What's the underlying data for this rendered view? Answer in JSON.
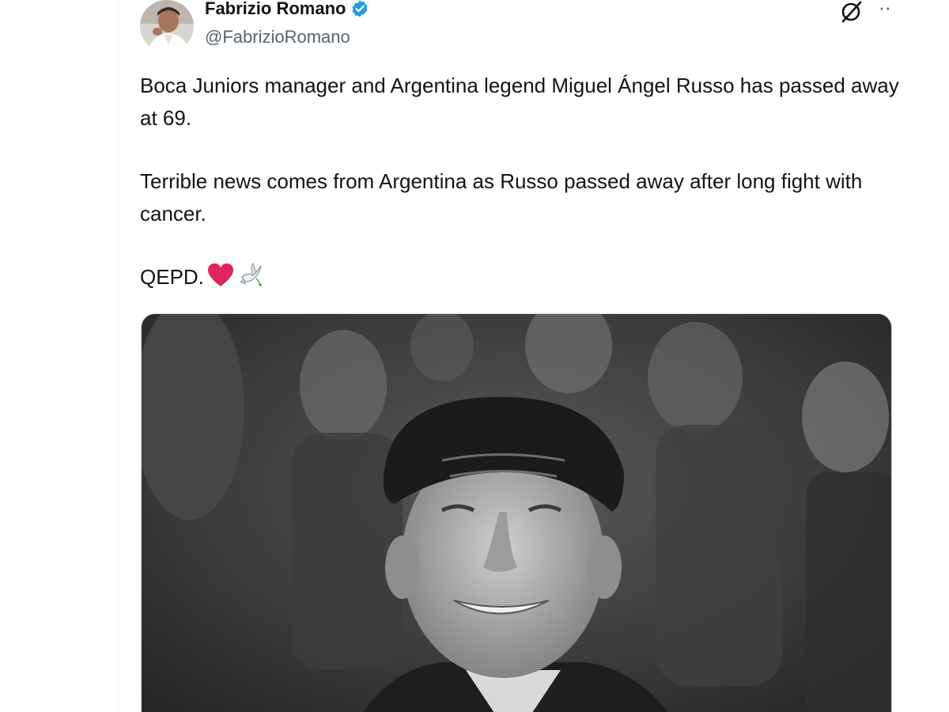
{
  "author": {
    "name": "Fabrizio Romano",
    "handle": "@FabrizioRomano",
    "verified": true,
    "avatar_icon": "profile-photo"
  },
  "actions": {
    "grok_icon": "grok-icon",
    "more_label": "··"
  },
  "tweet": {
    "paragraphs": [
      "Boca Juniors manager and Argentina legend Miguel Ángel Russo has passed away at 69.",
      "Terrible news comes from Argentina as Russo passed away after long fight with cancer.",
      "QEPD."
    ],
    "emojis": [
      "red-heart",
      "dove"
    ]
  },
  "media": {
    "type": "photo",
    "style": "black-and-white portrait"
  },
  "colors": {
    "verified_badge": "#1d9bf0",
    "heart": "#e0245e",
    "handle": "#536471"
  }
}
